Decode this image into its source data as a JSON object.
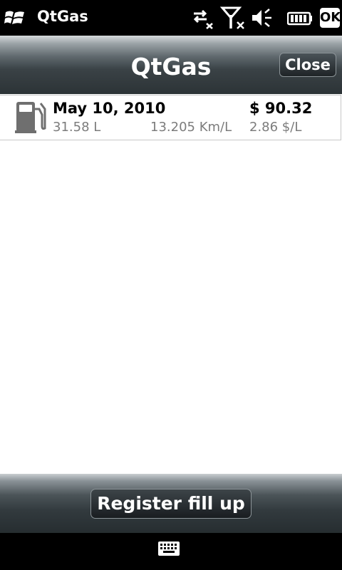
{
  "statusbar": {
    "app_name": "QtGas",
    "ok_label": "OK",
    "icons": [
      "windows-start-icon",
      "data-connection-off-icon",
      "signal-off-icon",
      "speaker-mute-icon",
      "battery-icon"
    ]
  },
  "header": {
    "title": "QtGas",
    "close_label": "Close"
  },
  "fillups": [
    {
      "date": "May 10, 2010",
      "price": "$ 90.32",
      "liters": "31.58 L",
      "efficiency": "13.205 Km/L",
      "price_per_liter": "2.86 $/L",
      "icon": "gas-pump-icon"
    }
  ],
  "footer": {
    "register_label": "Register fill up",
    "keyboard_icon": "keyboard-icon"
  },
  "colors": {
    "header_dark": "#2c3336",
    "secondary_text": "#7c7c7c"
  }
}
